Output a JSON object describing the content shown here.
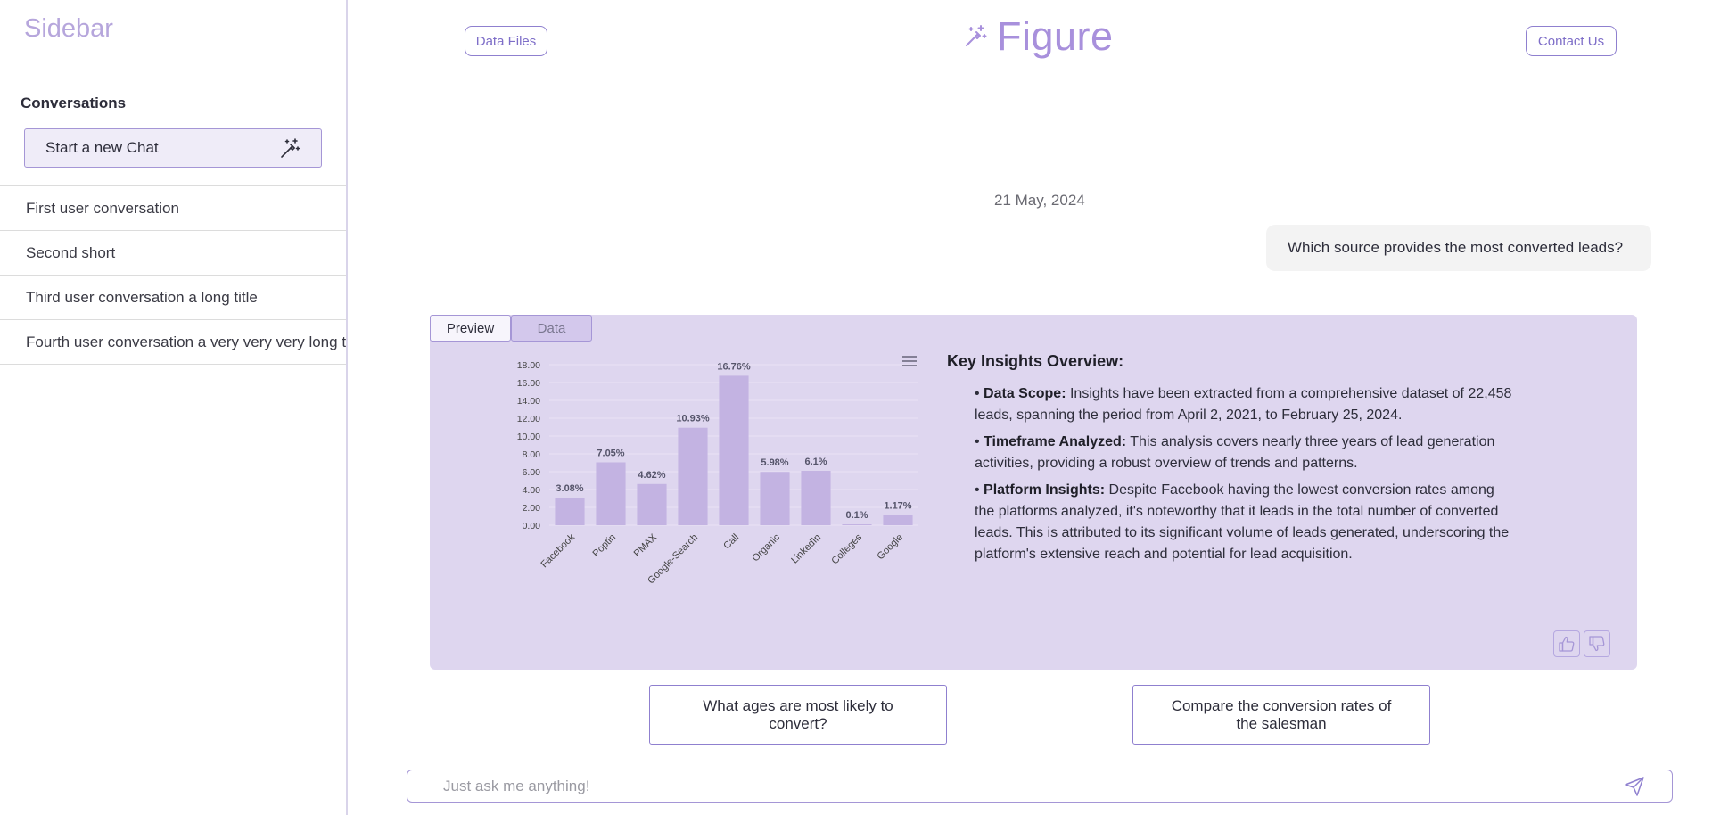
{
  "sidebar": {
    "title": "Sidebar",
    "conversations_heading": "Conversations",
    "new_chat_label": "Start a new Chat",
    "items": [
      {
        "label": "First user conversation"
      },
      {
        "label": "Second short"
      },
      {
        "label": "Third user conversation a long title"
      },
      {
        "label": "Fourth user conversation a very very very long title"
      }
    ]
  },
  "header": {
    "data_files_label": "Data Files",
    "logo_text": "Figure",
    "contact_label": "Contact Us"
  },
  "chat": {
    "date": "21 May, 2024",
    "user_message": "Which source provides the most converted leads?",
    "tabs": [
      {
        "label": "Preview"
      },
      {
        "label": "Data"
      }
    ],
    "insights_title": "Key Insights Overview:",
    "insights": [
      {
        "bold": "Data Scope:",
        "text": "Insights have been extracted from a comprehensive dataset of 22,458 leads, spanning the period from April 2, 2021, to February 25, 2024."
      },
      {
        "bold": "Timeframe Analyzed:",
        "text": "This analysis covers nearly three years of lead generation activities, providing a robust overview of trends and patterns."
      },
      {
        "bold": "Platform Insights:",
        "text": "Despite Facebook having the lowest conversion rates among the platforms analyzed, it's noteworthy that it leads in the total number of converted leads. This is attributed to its significant volume of leads generated, underscoring the platform's extensive reach and potential for lead acquisition."
      }
    ],
    "suggestions": [
      {
        "label": "What ages are most likely to convert?"
      },
      {
        "label": "Compare the conversion rates of the salesman"
      }
    ],
    "input_placeholder": "Just ask me anything!"
  },
  "colors": {
    "accent": "#8f80cf",
    "bar": "#c3b3e2",
    "card": "#ded6ef"
  },
  "icons": {
    "new_chat": "magic-wand-icon",
    "logo": "magic-wand-icon",
    "menu": "hamburger-menu-icon",
    "thumb_up": "thumb-up-icon",
    "thumb_down": "thumb-down-icon",
    "send": "send-icon"
  },
  "chart_data": {
    "type": "bar",
    "categories": [
      "Facebook",
      "Poptin",
      "PMAX",
      "Google-Search",
      "Call",
      "Organic",
      "LinkedIn",
      "Colleges",
      "Google"
    ],
    "values": [
      3.08,
      7.05,
      4.62,
      10.93,
      16.76,
      5.98,
      6.1,
      0.1,
      1.17
    ],
    "data_labels": [
      "3.08%",
      "7.05%",
      "4.62%",
      "10.93%",
      "16.76%",
      "5.98%",
      "6.1%",
      "0.1%",
      "1.17%"
    ],
    "yticks": [
      "0.00",
      "2.00",
      "4.00",
      "6.00",
      "8.00",
      "10.00",
      "12.00",
      "14.00",
      "16.00",
      "18.00"
    ],
    "ylim": [
      0,
      18
    ],
    "grid": true
  }
}
